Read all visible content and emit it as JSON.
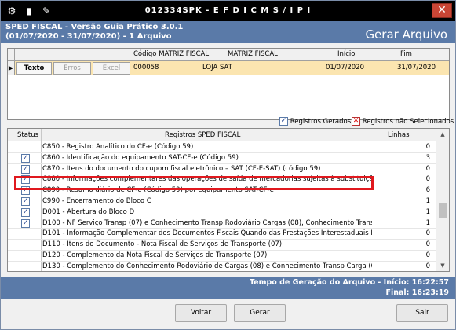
{
  "window": {
    "title": "012334SPK - E F D  I C M S / I P I"
  },
  "header": {
    "title": "SPED FISCAL - Versão Guia Prático 3.0.1",
    "subtitle": "(01/07/2020 - 31/07/2020) - 1 Arquivo",
    "action": "Gerar Arquivo"
  },
  "files_grid": {
    "columns": [
      "Código MATRIZ FISCAL",
      "MATRIZ FISCAL",
      "Início",
      "Fim"
    ],
    "buttons": {
      "texto": "Texto",
      "erros": "Erros",
      "excel": "Excel"
    },
    "rows": [
      {
        "codigo": "000058",
        "matriz": "LOJA SAT",
        "inicio": "01/07/2020",
        "fim": "31/07/2020"
      }
    ]
  },
  "legend": {
    "generated": "Registros Gerados",
    "not_selected": "Registros não Selecionados"
  },
  "records_grid": {
    "columns": {
      "status": "Status",
      "registros": "Registros SPED FISCAL",
      "linhas": "Linhas"
    },
    "rows": [
      {
        "desc": "C850 - Registro Analítico do CF-e (Código 59)",
        "lines": "0",
        "checked": false
      },
      {
        "desc": "C860 - Identificação do equipamento SAT-CF-e (Código 59)",
        "lines": "3",
        "checked": true
      },
      {
        "desc": "C870 - Itens do documento do cupom fiscal eletrônico – SAT (CF-E-SAT) (código 59)",
        "lines": "0",
        "checked": true
      },
      {
        "desc": "C880 - Informações complementares das operações de saída de mercadorias sujeitas à substituição tribu",
        "lines": "0",
        "checked": true
      },
      {
        "desc": "C890 - Resumo diário de CF-e (Código 59) por equipamento SAT-CF-e",
        "lines": "6",
        "checked": true
      },
      {
        "desc": "C990 - Encerramento do Bloco C",
        "lines": "1",
        "checked": true
      },
      {
        "desc": "D001 - Abertura do Bloco D",
        "lines": "1",
        "checked": true
      },
      {
        "desc": "D100 - NF Serviço Transp (07) e Conhecimento Transp Rodoviário Cargas (08), Conhecimento Transp Ca",
        "lines": "1",
        "checked": true
      },
      {
        "desc": "D101 - Informação Complementar dos Documentos Fiscais Quando das Prestações Interestaduais Destin",
        "lines": "0",
        "checked": false
      },
      {
        "desc": "D110 - Itens do Documento - Nota Fiscal de Serviços de Transporte (07)",
        "lines": "0",
        "checked": false
      },
      {
        "desc": "D120 - Complemento da Nota Fiscal de Serviços de Transporte (07)",
        "lines": "0",
        "checked": false
      },
      {
        "desc": "D130 - Complemento do Conhecimento Rodoviário de Cargas (08) e Conhecimento Transp Carga (08B)",
        "lines": "0",
        "checked": false
      }
    ]
  },
  "status": {
    "start": "Tempo de Geração do Arquivo - Início: 16:22:57",
    "end": "Final: 16:23:19"
  },
  "buttons": {
    "voltar": "Voltar",
    "gerar": "Gerar",
    "sair": "Sair"
  }
}
